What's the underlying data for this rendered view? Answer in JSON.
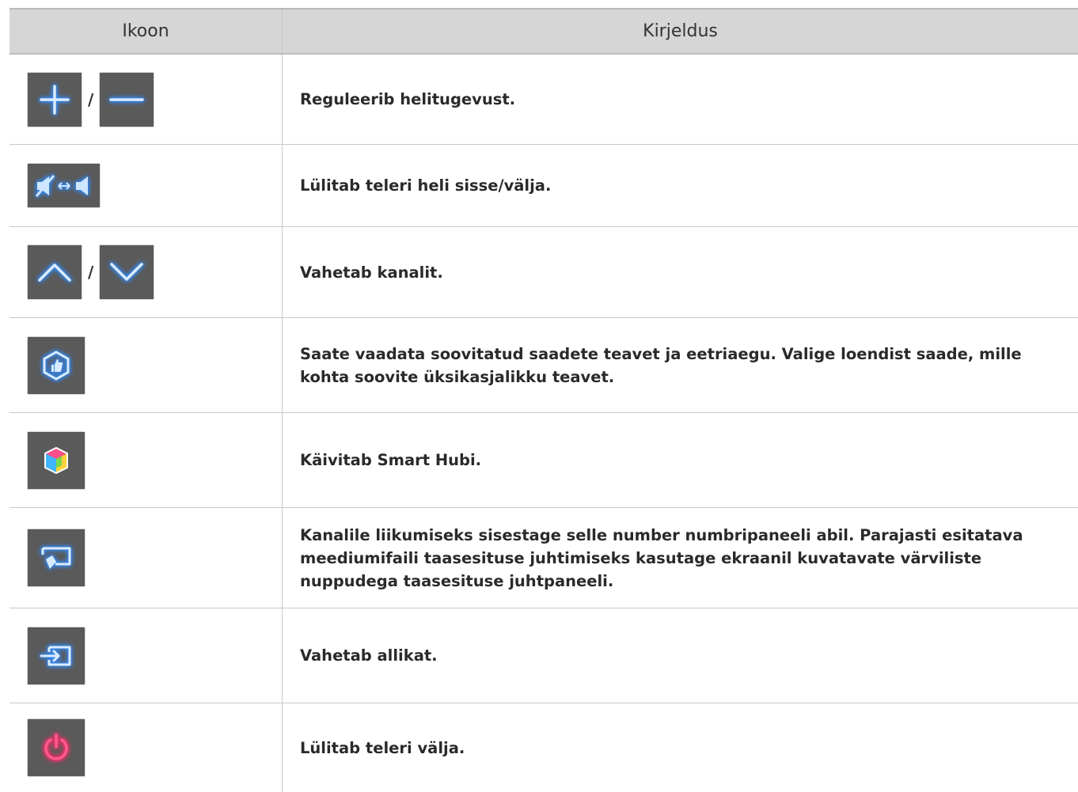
{
  "header": {
    "icon_col": "Ikoon",
    "desc_col": "Kirjeldus"
  },
  "rows": [
    {
      "icons": [
        "plus-icon",
        "minus-icon"
      ],
      "separator": "/",
      "description": "Reguleerib helitugevust."
    },
    {
      "icons": [
        "mute-toggle-icon"
      ],
      "description": "Lülitab teleri heli sisse/välja."
    },
    {
      "icons": [
        "chevron-up-icon",
        "chevron-down-icon"
      ],
      "separator": "/",
      "description": "Vahetab kanalit."
    },
    {
      "icons": [
        "recommended-icon"
      ],
      "description": "Saate vaadata soovitatud saadete teavet ja eetriaegu. Valige loendist saade, mille kohta soovite üksikasjalikku teavet."
    },
    {
      "icons": [
        "smart-hub-icon"
      ],
      "description": "Käivitab Smart Hubi."
    },
    {
      "icons": [
        "remote-panel-icon"
      ],
      "description": "Kanalile liikumiseks sisestage selle number numbripaneeli abil. Parajasti esitatava meediumifaili taasesituse juhtimiseks kasutage ekraanil kuvatavate värviliste nuppudega taasesituse juhtpaneeli."
    },
    {
      "icons": [
        "source-icon"
      ],
      "description": "Vahetab allikat."
    },
    {
      "icons": [
        "power-icon"
      ],
      "description": "Lülitab teleri välja."
    }
  ],
  "colors": {
    "header_bg": "#d6d6d6",
    "button_bg": "#5a5a5a",
    "icon_glow": "#2f8cff",
    "power_glow": "#ff2a6a"
  }
}
